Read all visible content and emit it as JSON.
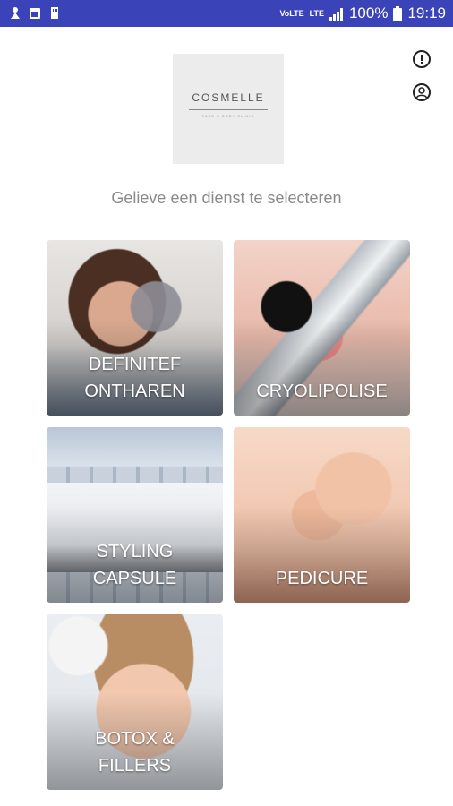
{
  "status_bar": {
    "volte": "VoLTE",
    "lte": "LTE",
    "battery_percent": "100%",
    "time": "19:19"
  },
  "logo": {
    "name": "COSMELLE",
    "tagline": "FACE & BODY CLINIC"
  },
  "header": {
    "subtitle": "Gelieve een dienst te selecteren"
  },
  "services": [
    {
      "line1": "DEFINITEF",
      "line2": "ONTHAREN"
    },
    {
      "line1": "CRYOLIPOLISE",
      "line2": ""
    },
    {
      "line1": "STYLING",
      "line2": "CAPSULE"
    },
    {
      "line1": "PEDICURE",
      "line2": ""
    },
    {
      "line1": "BOTOX &",
      "line2": "FILLERS"
    }
  ],
  "icons": {
    "info": "info-icon",
    "profile": "account-icon"
  }
}
